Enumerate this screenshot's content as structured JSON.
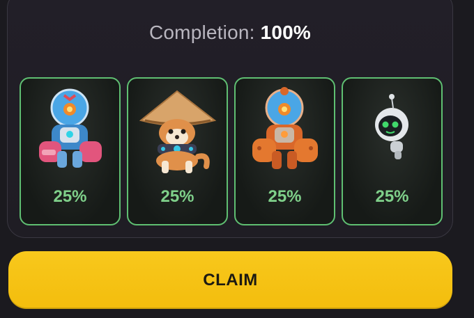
{
  "completion": {
    "label": "Completion:",
    "value": "100%"
  },
  "cards": [
    {
      "name": "robot-diver-icon",
      "accent": "#3f8fd6",
      "percent": "25%"
    },
    {
      "name": "shiba-dog-hat-icon",
      "accent": "#d89a55",
      "percent": "25%"
    },
    {
      "name": "robot-diver-orange-icon",
      "accent": "#e07a32",
      "percent": "25%"
    },
    {
      "name": "mini-robot-icon",
      "accent": "#41d86b",
      "percent": "25%"
    }
  ],
  "claim": {
    "label": "CLAIM",
    "color": "#f6c416"
  },
  "colors": {
    "card_border": "#5fbf72",
    "percent_text": "#7fd08a",
    "background": "#1b1a1f"
  }
}
